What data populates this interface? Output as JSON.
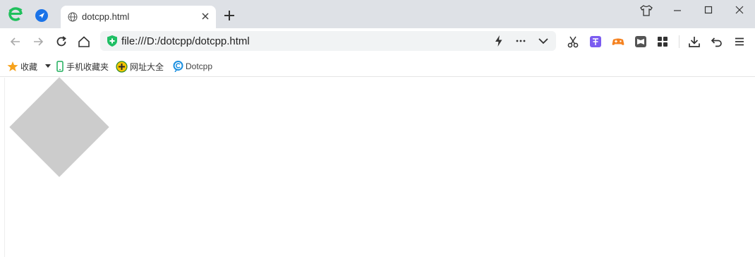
{
  "tab": {
    "title": "dotcpp.html"
  },
  "address": {
    "url": "file:///D:/dotcpp/dotcpp.html"
  },
  "bookmarks": [
    {
      "label": "收藏",
      "icon": "star-icon"
    },
    {
      "label": "手机收藏夹",
      "icon": "phone-icon"
    },
    {
      "label": "网址大全",
      "icon": "compass-icon"
    },
    {
      "label": "Dotcpp",
      "icon": "dotcpp-icon"
    }
  ],
  "page": {
    "shape": "diamond",
    "shape_color": "#cccccc"
  }
}
